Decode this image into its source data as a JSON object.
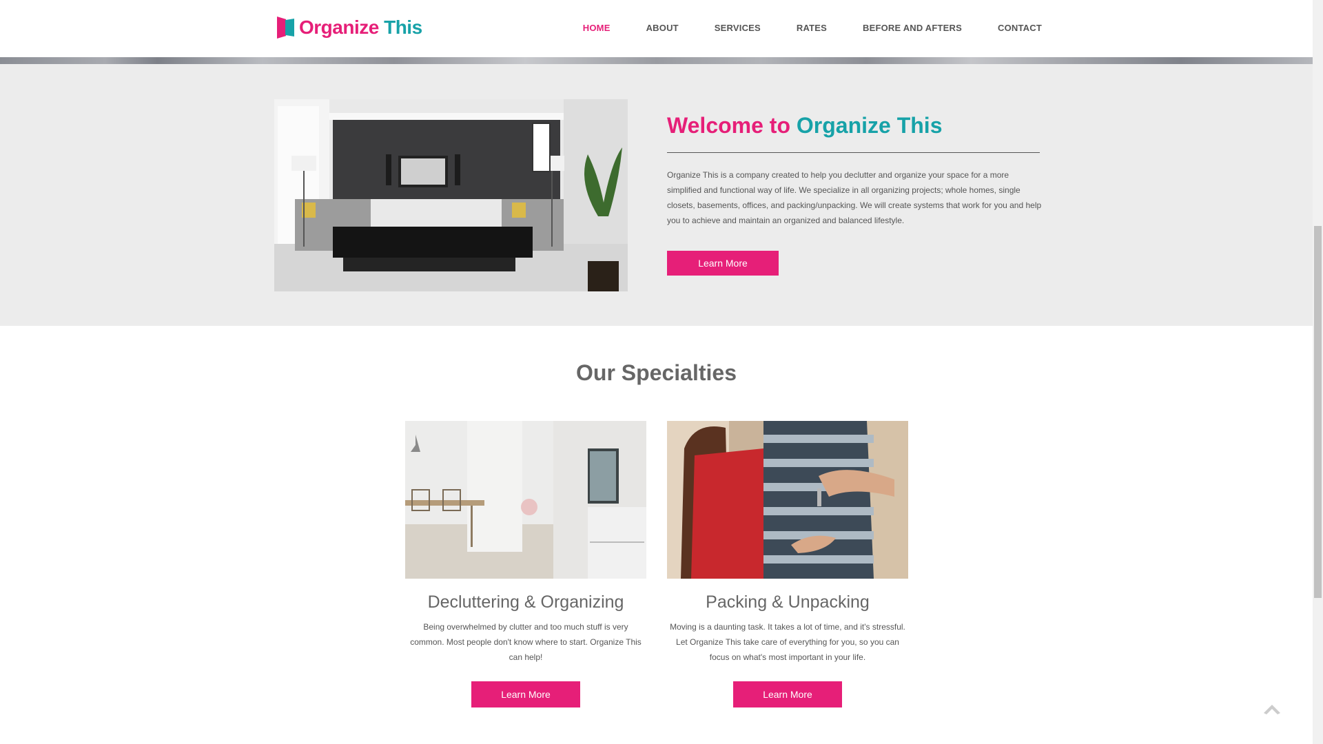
{
  "brand": {
    "name_part1": "Organize",
    "name_part2": "This",
    "color_pink": "#e61f78",
    "color_teal": "#17a2a8"
  },
  "nav": {
    "items": [
      {
        "label": "HOME",
        "active": true
      },
      {
        "label": "ABOUT",
        "active": false
      },
      {
        "label": "SERVICES",
        "active": false
      },
      {
        "label": "RATES",
        "active": false
      },
      {
        "label": "BEFORE AND AFTERS",
        "active": false
      },
      {
        "label": "CONTACT",
        "active": false
      }
    ]
  },
  "welcome": {
    "title_part1": "Welcome to",
    "title_part2": "Organize This",
    "text": "Organize This is a company created to help you declutter and organize your space for a more simplified and functional way of life. We specialize in all organizing projects; whole homes, single closets, basements, offices, and packing/unpacking. We will create systems that work for you and help you to achieve and maintain an organized and balanced lifestyle.",
    "button": "Learn More",
    "image": "living-room-photo"
  },
  "specialties": {
    "title": "Our Specialties",
    "cards": [
      {
        "title": "Decluttering & Organizing",
        "text": "Being overwhelmed by clutter and too much stuff is very common. Most people don't know where to start. Organize This can help!",
        "button": "Learn More",
        "image": "dining-room-photo"
      },
      {
        "title": "Packing & Unpacking",
        "text": "Moving is a daunting task. It takes a lot of time, and it's stressful. Let Organize This take care of everything for you, so you can focus on what's most important in your life.",
        "button": "Learn More",
        "image": "couple-with-keys-photo"
      }
    ]
  },
  "icons": {
    "back_to_top": "chevron-up-icon"
  }
}
